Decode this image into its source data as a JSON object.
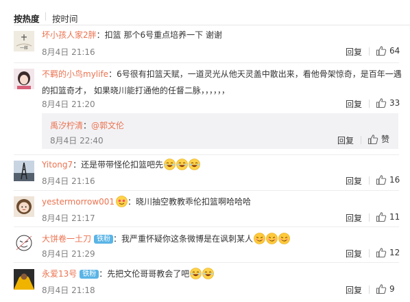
{
  "sort": {
    "hot_label": "按热度",
    "time_label": "按时间"
  },
  "comments": [
    {
      "user": "坏小孩人家2胖",
      "text": "：扣篮 那个6号重点培养一下 谢谢",
      "time": "8月4日 21:16",
      "reply_label": "回复",
      "likes": "64"
    },
    {
      "user": "不羁的小鸟mylife",
      "text_line1": "：6号很有扣篮天赋，一道灵光从他天灵盖中散出来，看他骨架惊奇，是百年一遇",
      "text_line2": "的扣篮奇才， 如果晓川能打通他的任督二脉，，，，，，",
      "time": "8月4日 21:20",
      "reply_label": "回复",
      "likes": "33"
    },
    {
      "user": "Yitong7",
      "text": "：还是带带怪伦扣篮吧先",
      "time": "8月4日 21:16",
      "reply_label": "回复",
      "likes": "16"
    },
    {
      "user": "yestermorrow001",
      "text": "：晓川抽空教教乖伦扣篮啊哈哈哈",
      "time": "8月4日 21:17",
      "reply_label": "回复",
      "likes": "11"
    },
    {
      "user": "大饼卷一土刀",
      "badge": "铁粉",
      "text": "：我严重怀疑你这条微博是在讽刺某人",
      "time": "8月4日 21:29",
      "reply_label": "回复",
      "likes": "12"
    },
    {
      "user": "永爱13号",
      "badge": "铁粉",
      "text": "：先把文伦哥哥教会了吧",
      "time": "8月4日 21:18",
      "reply_label": "回复",
      "likes": "9"
    }
  ],
  "nested_reply": {
    "user": "禹汐柠清",
    "text": "：",
    "mention": "@郭文伦",
    "time": "8月4日 22:40",
    "reply_label": "回复",
    "like_label": "赞"
  },
  "avatar_label": "一样",
  "icons": {
    "like": "thumbs-up-icon",
    "laugh": "laughing-emoji-icon",
    "smirk": "smirk-emoji-icon",
    "fan_badge": "fan-badge-icon"
  },
  "colors": {
    "username": "#eb7350",
    "badge": "#5ab4e6",
    "meta": "#808080"
  }
}
